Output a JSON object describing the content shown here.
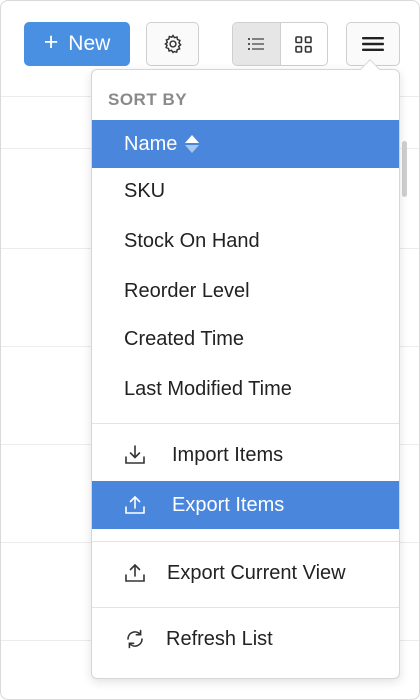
{
  "toolbar": {
    "new_button": {
      "label": "New",
      "plus": "+"
    },
    "settings_icon": "gear-icon",
    "view_list_icon": "list-view-icon",
    "view_grid_icon": "grid-view-icon",
    "menu_icon": "hamburger-menu-icon"
  },
  "sort_menu": {
    "section_title": "SORT BY",
    "sort_options": [
      {
        "label": "Name",
        "selected": true
      },
      {
        "label": "SKU"
      },
      {
        "label": "Stock On Hand"
      },
      {
        "label": "Reorder Level"
      },
      {
        "label": "Created Time"
      },
      {
        "label": "Last Modified Time"
      }
    ],
    "actions": [
      {
        "label": "Import Items",
        "icon": "import-icon"
      },
      {
        "label": "Export Items",
        "icon": "export-icon",
        "highlighted": true
      },
      {
        "label": "Export Current View",
        "icon": "export-icon"
      },
      {
        "label": "Refresh List",
        "icon": "refresh-icon"
      }
    ]
  },
  "colors": {
    "accent": "#4a90e2",
    "highlight": "#4a87dc",
    "muted_text": "#8a8a8a"
  }
}
